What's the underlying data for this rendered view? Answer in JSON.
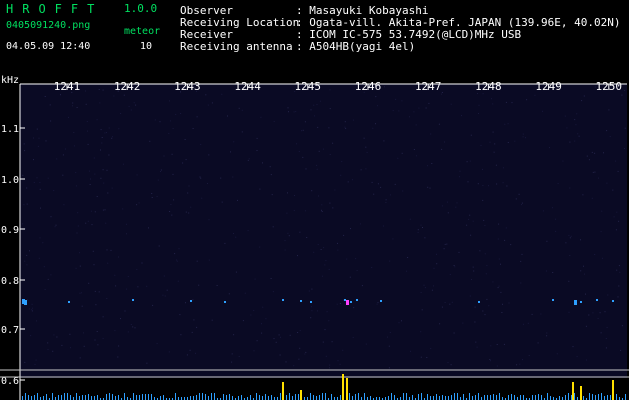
{
  "header": {
    "app_title": "HROFFT",
    "version": "1.0.0",
    "file_name": "0405091240.png",
    "meteor_label": "meteor",
    "datetime": "04.05.09 12:40",
    "meteor_count": "10"
  },
  "info": [
    {
      "key": "Observer",
      "value": ": Masayuki Kobayashi"
    },
    {
      "key": "Receiving Location",
      "value": ": Ogata-vill. Akita-Pref. JAPAN (139.96E, 40.02N)"
    },
    {
      "key": "Receiver",
      "value": ": ICOM IC-575 53.7492(@LCD)MHz USB"
    },
    {
      "key": "Receiving antenna",
      "value": ": A504HB(yagi 4el)"
    }
  ],
  "axes": {
    "y_unit": "kHz",
    "x_ticks": [
      "1241",
      "1242",
      "1243",
      "1244",
      "1245",
      "1246",
      "1247",
      "1248",
      "1249",
      "1250"
    ],
    "y_ticks": [
      "1.1",
      "1.0",
      "0.9",
      "0.8",
      "0.7",
      "0.6"
    ]
  },
  "colors": {
    "background": "#000000",
    "plot_background": "#0a0a24",
    "text": "#ffffff",
    "accent": "#00e060",
    "echo": "#2ea0ff",
    "spike": "#ffe000"
  }
}
